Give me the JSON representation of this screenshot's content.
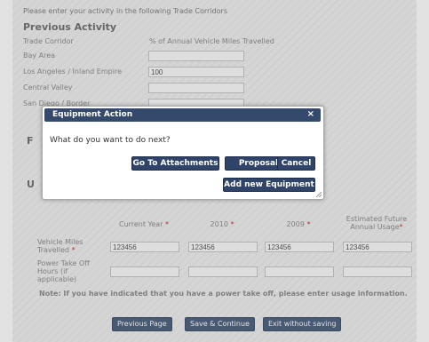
{
  "form": {
    "intro": "Please enter your activity in the following Trade Corridors",
    "previous_activity_title": "Previous Activity",
    "corridor_header": "Trade Corridor",
    "percent_header": "% of Annual Vehicle Miles Travelled",
    "corridors": [
      {
        "label": "Bay Area",
        "value": ""
      },
      {
        "label": "Los Angeles / Inland Empire",
        "value": "100"
      },
      {
        "label": "Central Valley",
        "value": ""
      },
      {
        "label": "San Diego / Border",
        "value": ""
      }
    ],
    "section_letters": [
      "F",
      "U"
    ]
  },
  "usage": {
    "columns": [
      {
        "label": "Current Year",
        "required": true
      },
      {
        "label": "2010",
        "required": true
      },
      {
        "label": "2009",
        "required": true
      },
      {
        "label": "Estimated Future Annual Usage",
        "required": true
      }
    ],
    "vehicle_miles_label": "Vehicle Miles Travelled",
    "vehicle_miles_values": [
      "123456",
      "123456",
      "123456",
      "123456"
    ],
    "pto_label": "Power Take Off Hours (if applicable)",
    "pto_values": [
      "",
      "",
      "",
      ""
    ],
    "required_marker": "*",
    "note": "Note: If you have indicated that you have a power take off, please enter usage information."
  },
  "nav": {
    "previous": "Previous Page",
    "save": "Save & Continue",
    "exit": "Exit without saving"
  },
  "dialog": {
    "title": "Equipment Action",
    "close_glyph": "×",
    "message": "What do you want to do next?",
    "buttons": {
      "attachments": "Go To Attachments",
      "proposal_home": "Proposal Home",
      "cancel": "Cancel",
      "add_equipment": "Add new Equipment"
    }
  }
}
